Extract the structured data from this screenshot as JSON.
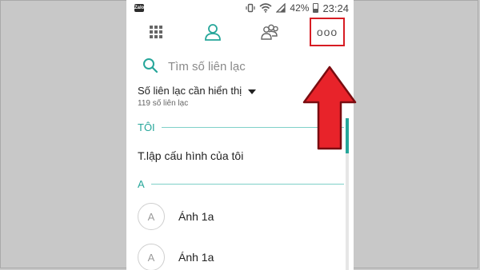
{
  "status_bar": {
    "app_badge": "Zalo",
    "battery_percent": "42%",
    "time": "23:24"
  },
  "toolbar": {
    "icons": [
      "apps-grid-icon",
      "person-icon",
      "group-icon",
      "more-options-icon"
    ],
    "more_label": "ooo"
  },
  "search": {
    "placeholder": "Tìm số liên lạc"
  },
  "filter": {
    "title": "Số liên lạc cần hiển thị",
    "count": "119 số liên lạc"
  },
  "sections": [
    {
      "header": "TÔI",
      "items": [
        "T.lập cấu hình của tôi"
      ]
    },
    {
      "header": "A",
      "items": [
        {
          "initial": "A",
          "name": "Ánh 1a"
        },
        {
          "initial": "A",
          "name": "Ánh 1a"
        }
      ]
    }
  ],
  "colors": {
    "accent": "#26a69a",
    "highlight": "#d71c23"
  },
  "scroll": {
    "position_fraction": 0.0
  }
}
